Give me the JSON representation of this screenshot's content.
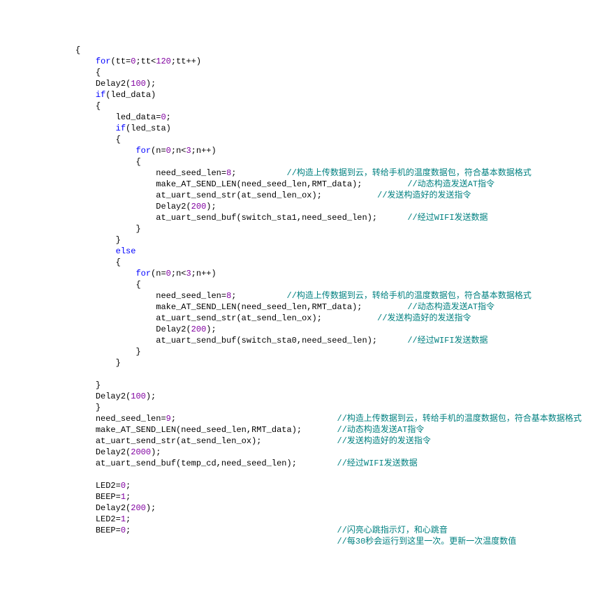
{
  "lines": [
    {
      "indent": 2,
      "parts": [
        {
          "c": "pn",
          "t": "{"
        }
      ]
    },
    {
      "indent": 3,
      "parts": [
        {
          "c": "kw",
          "t": "for"
        },
        {
          "c": "pn",
          "t": "("
        },
        {
          "c": "id",
          "t": "tt"
        },
        {
          "c": "pn",
          "t": "="
        },
        {
          "c": "num",
          "t": "0"
        },
        {
          "c": "pn",
          "t": ";"
        },
        {
          "c": "id",
          "t": "tt"
        },
        {
          "c": "pn",
          "t": "<"
        },
        {
          "c": "num",
          "t": "120"
        },
        {
          "c": "pn",
          "t": ";"
        },
        {
          "c": "id",
          "t": "tt"
        },
        {
          "c": "pn",
          "t": "++)"
        }
      ],
      "comment": "",
      "commentCol": 56
    },
    {
      "indent": 3,
      "parts": [
        {
          "c": "pn",
          "t": "{"
        }
      ]
    },
    {
      "indent": 3,
      "parts": [
        {
          "c": "id",
          "t": "Delay2"
        },
        {
          "c": "pn",
          "t": "("
        },
        {
          "c": "num",
          "t": "100"
        },
        {
          "c": "pn",
          "t": ");"
        }
      ]
    },
    {
      "indent": 3,
      "parts": [
        {
          "c": "kw",
          "t": "if"
        },
        {
          "c": "pn",
          "t": "("
        },
        {
          "c": "id",
          "t": "led_data"
        },
        {
          "c": "pn",
          "t": ")"
        }
      ]
    },
    {
      "indent": 3,
      "parts": [
        {
          "c": "pn",
          "t": "{"
        }
      ]
    },
    {
      "indent": 4,
      "parts": [
        {
          "c": "id",
          "t": "led_data"
        },
        {
          "c": "pn",
          "t": "="
        },
        {
          "c": "num",
          "t": "0"
        },
        {
          "c": "pn",
          "t": ";"
        }
      ]
    },
    {
      "indent": 4,
      "parts": [
        {
          "c": "kw",
          "t": "if"
        },
        {
          "c": "pn",
          "t": "("
        },
        {
          "c": "id",
          "t": "led_sta"
        },
        {
          "c": "pn",
          "t": ")"
        }
      ]
    },
    {
      "indent": 4,
      "parts": [
        {
          "c": "pn",
          "t": "{"
        }
      ]
    },
    {
      "indent": 5,
      "parts": [
        {
          "c": "kw",
          "t": "for"
        },
        {
          "c": "pn",
          "t": "("
        },
        {
          "c": "id",
          "t": "n"
        },
        {
          "c": "pn",
          "t": "="
        },
        {
          "c": "num",
          "t": "0"
        },
        {
          "c": "pn",
          "t": ";"
        },
        {
          "c": "id",
          "t": "n"
        },
        {
          "c": "pn",
          "t": "<"
        },
        {
          "c": "num",
          "t": "3"
        },
        {
          "c": "pn",
          "t": ";"
        },
        {
          "c": "id",
          "t": "n"
        },
        {
          "c": "pn",
          "t": "++)"
        }
      ]
    },
    {
      "indent": 5,
      "parts": [
        {
          "c": "pn",
          "t": "{"
        }
      ]
    },
    {
      "indent": 6,
      "parts": [
        {
          "c": "id",
          "t": "need_seed_len"
        },
        {
          "c": "pn",
          "t": "="
        },
        {
          "c": "num",
          "t": "8"
        },
        {
          "c": "pn",
          "t": ";"
        }
      ],
      "comment": "//构造上传数据到云，转给手机的温度数据包，符合基本数据格式",
      "commentCol": 50
    },
    {
      "indent": 6,
      "parts": [
        {
          "c": "id",
          "t": "make_AT_SEND_LEN"
        },
        {
          "c": "pn",
          "t": "("
        },
        {
          "c": "id",
          "t": "need_seed_len"
        },
        {
          "c": "pn",
          "t": ","
        },
        {
          "c": "id",
          "t": "RMT_data"
        },
        {
          "c": "pn",
          "t": ");"
        }
      ],
      "comment": "//动态构造发送AT指令",
      "commentCol": 74
    },
    {
      "indent": 6,
      "parts": [
        {
          "c": "id",
          "t": "at_uart_send_str"
        },
        {
          "c": "pn",
          "t": "("
        },
        {
          "c": "id",
          "t": "at_send_len_ox"
        },
        {
          "c": "pn",
          "t": ");"
        }
      ],
      "comment": "//发送构造好的发送指令",
      "commentCol": 68
    },
    {
      "indent": 6,
      "parts": [
        {
          "c": "id",
          "t": "Delay2"
        },
        {
          "c": "pn",
          "t": "("
        },
        {
          "c": "num",
          "t": "200"
        },
        {
          "c": "pn",
          "t": ");"
        }
      ]
    },
    {
      "indent": 6,
      "parts": [
        {
          "c": "id",
          "t": "at_uart_send_buf"
        },
        {
          "c": "pn",
          "t": "("
        },
        {
          "c": "id",
          "t": "switch_sta1"
        },
        {
          "c": "pn",
          "t": ","
        },
        {
          "c": "id",
          "t": "need_seed_len"
        },
        {
          "c": "pn",
          "t": ");"
        }
      ],
      "comment": "//经过WIFI发送数据",
      "commentCol": 74
    },
    {
      "indent": 5,
      "parts": [
        {
          "c": "pn",
          "t": "}"
        }
      ]
    },
    {
      "indent": 4,
      "parts": [
        {
          "c": "pn",
          "t": "}"
        }
      ]
    },
    {
      "indent": 4,
      "parts": [
        {
          "c": "kw",
          "t": "else"
        }
      ]
    },
    {
      "indent": 4,
      "parts": [
        {
          "c": "pn",
          "t": "{"
        }
      ]
    },
    {
      "indent": 5,
      "parts": [
        {
          "c": "kw",
          "t": "for"
        },
        {
          "c": "pn",
          "t": "("
        },
        {
          "c": "id",
          "t": "n"
        },
        {
          "c": "pn",
          "t": "="
        },
        {
          "c": "num",
          "t": "0"
        },
        {
          "c": "pn",
          "t": ";"
        },
        {
          "c": "id",
          "t": "n"
        },
        {
          "c": "pn",
          "t": "<"
        },
        {
          "c": "num",
          "t": "3"
        },
        {
          "c": "pn",
          "t": ";"
        },
        {
          "c": "id",
          "t": "n"
        },
        {
          "c": "pn",
          "t": "++)"
        }
      ]
    },
    {
      "indent": 5,
      "parts": [
        {
          "c": "pn",
          "t": "{"
        }
      ]
    },
    {
      "indent": 6,
      "parts": [
        {
          "c": "id",
          "t": "need_seed_len"
        },
        {
          "c": "pn",
          "t": "="
        },
        {
          "c": "num",
          "t": "8"
        },
        {
          "c": "pn",
          "t": ";"
        }
      ],
      "comment": "//构造上传数据到云，转给手机的温度数据包，符合基本数据格式",
      "commentCol": 50
    },
    {
      "indent": 6,
      "parts": [
        {
          "c": "id",
          "t": "make_AT_SEND_LEN"
        },
        {
          "c": "pn",
          "t": "("
        },
        {
          "c": "id",
          "t": "need_seed_len"
        },
        {
          "c": "pn",
          "t": ","
        },
        {
          "c": "id",
          "t": "RMT_data"
        },
        {
          "c": "pn",
          "t": ");"
        }
      ],
      "comment": "//动态构造发送AT指令",
      "commentCol": 74
    },
    {
      "indent": 6,
      "parts": [
        {
          "c": "id",
          "t": "at_uart_send_str"
        },
        {
          "c": "pn",
          "t": "("
        },
        {
          "c": "id",
          "t": "at_send_len_ox"
        },
        {
          "c": "pn",
          "t": ");"
        }
      ],
      "comment": "//发送构造好的发送指令",
      "commentCol": 68
    },
    {
      "indent": 6,
      "parts": [
        {
          "c": "id",
          "t": "Delay2"
        },
        {
          "c": "pn",
          "t": "("
        },
        {
          "c": "num",
          "t": "200"
        },
        {
          "c": "pn",
          "t": ");"
        }
      ]
    },
    {
      "indent": 6,
      "parts": [
        {
          "c": "id",
          "t": "at_uart_send_buf"
        },
        {
          "c": "pn",
          "t": "("
        },
        {
          "c": "id",
          "t": "switch_sta0"
        },
        {
          "c": "pn",
          "t": ","
        },
        {
          "c": "id",
          "t": "need_seed_len"
        },
        {
          "c": "pn",
          "t": ");"
        }
      ],
      "comment": "//经过WIFI发送数据",
      "commentCol": 74
    },
    {
      "indent": 5,
      "parts": [
        {
          "c": "pn",
          "t": "}"
        }
      ]
    },
    {
      "indent": 4,
      "parts": [
        {
          "c": "pn",
          "t": "}"
        }
      ]
    },
    {
      "indent": 0,
      "parts": []
    },
    {
      "indent": 3,
      "parts": [
        {
          "c": "pn",
          "t": "}"
        }
      ]
    },
    {
      "indent": 3,
      "parts": [
        {
          "c": "id",
          "t": "Delay2"
        },
        {
          "c": "pn",
          "t": "("
        },
        {
          "c": "num",
          "t": "100"
        },
        {
          "c": "pn",
          "t": ");"
        }
      ]
    },
    {
      "indent": 3,
      "parts": [
        {
          "c": "pn",
          "t": "}"
        }
      ]
    },
    {
      "indent": 3,
      "parts": [
        {
          "c": "id",
          "t": "need_seed_len"
        },
        {
          "c": "pn",
          "t": "="
        },
        {
          "c": "num",
          "t": "9"
        },
        {
          "c": "pn",
          "t": ";"
        }
      ],
      "comment": "//构造上传数据到云，转给手机的温度数据包，符合基本数据格式",
      "commentCol": 60
    },
    {
      "indent": 3,
      "parts": [
        {
          "c": "id",
          "t": "make_AT_SEND_LEN"
        },
        {
          "c": "pn",
          "t": "("
        },
        {
          "c": "id",
          "t": "need_seed_len"
        },
        {
          "c": "pn",
          "t": ","
        },
        {
          "c": "id",
          "t": "RMT_data"
        },
        {
          "c": "pn",
          "t": ");"
        }
      ],
      "comment": "//动态构造发送AT指令",
      "commentCol": 60
    },
    {
      "indent": 3,
      "parts": [
        {
          "c": "id",
          "t": "at_uart_send_str"
        },
        {
          "c": "pn",
          "t": "("
        },
        {
          "c": "id",
          "t": "at_send_len_ox"
        },
        {
          "c": "pn",
          "t": ");"
        }
      ],
      "comment": "//发送构造好的发送指令",
      "commentCol": 60
    },
    {
      "indent": 3,
      "parts": [
        {
          "c": "id",
          "t": "Delay2"
        },
        {
          "c": "pn",
          "t": "("
        },
        {
          "c": "num",
          "t": "2000"
        },
        {
          "c": "pn",
          "t": ");"
        }
      ]
    },
    {
      "indent": 3,
      "parts": [
        {
          "c": "id",
          "t": "at_uart_send_buf"
        },
        {
          "c": "pn",
          "t": "("
        },
        {
          "c": "id",
          "t": "temp_cd"
        },
        {
          "c": "pn",
          "t": ","
        },
        {
          "c": "id",
          "t": "need_seed_len"
        },
        {
          "c": "pn",
          "t": ");"
        }
      ],
      "comment": "//经过WIFI发送数据",
      "commentCol": 60
    },
    {
      "indent": 0,
      "parts": []
    },
    {
      "indent": 3,
      "parts": [
        {
          "c": "id",
          "t": "LED2"
        },
        {
          "c": "pn",
          "t": "="
        },
        {
          "c": "num",
          "t": "0"
        },
        {
          "c": "pn",
          "t": ";"
        }
      ]
    },
    {
      "indent": 3,
      "parts": [
        {
          "c": "id",
          "t": "BEEP"
        },
        {
          "c": "pn",
          "t": "="
        },
        {
          "c": "num",
          "t": "1"
        },
        {
          "c": "pn",
          "t": ";"
        }
      ]
    },
    {
      "indent": 3,
      "parts": [
        {
          "c": "id",
          "t": "Delay2"
        },
        {
          "c": "pn",
          "t": "("
        },
        {
          "c": "num",
          "t": "200"
        },
        {
          "c": "pn",
          "t": ");"
        }
      ]
    },
    {
      "indent": 3,
      "parts": [
        {
          "c": "id",
          "t": "LED2"
        },
        {
          "c": "pn",
          "t": "="
        },
        {
          "c": "num",
          "t": "1"
        },
        {
          "c": "pn",
          "t": ";"
        }
      ]
    },
    {
      "indent": 3,
      "parts": [
        {
          "c": "id",
          "t": "BEEP"
        },
        {
          "c": "pn",
          "t": "="
        },
        {
          "c": "num",
          "t": "0"
        },
        {
          "c": "pn",
          "t": ";"
        }
      ],
      "comment": "//闪亮心跳指示灯，和心跳音",
      "commentCol": 60
    },
    {
      "indent": 3,
      "parts": [],
      "comment": "//每30秒会运行到这里一次。更新一次温度数值",
      "commentCol": 60
    }
  ],
  "indentUnit": "    ",
  "baseIndent": "       "
}
